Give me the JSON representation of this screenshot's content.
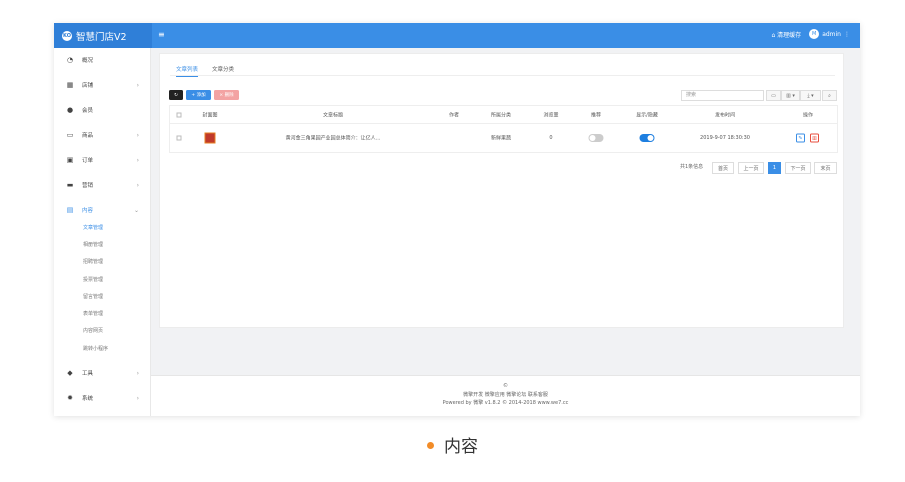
{
  "app": {
    "brand_logo": "KO",
    "brand_name": "智慧门店V2",
    "menu_toggle": "≡",
    "clear_cache": "清理缓存",
    "user_initial": "M",
    "user_name": "admin",
    "more_icon": "⋮"
  },
  "sidebar": {
    "items": [
      {
        "icon": "dashboard-icon",
        "glyph": "◔",
        "label": "概况",
        "has_arrow": false
      },
      {
        "icon": "grid-icon",
        "glyph": "▦",
        "label": "店铺",
        "has_arrow": true
      },
      {
        "icon": "users-icon",
        "glyph": "●",
        "label": "会员",
        "has_arrow": false
      },
      {
        "icon": "cart-icon",
        "glyph": "▭",
        "label": "商品",
        "has_arrow": true
      },
      {
        "icon": "order-icon",
        "glyph": "▣",
        "label": "订单",
        "has_arrow": true
      },
      {
        "icon": "flag-icon",
        "glyph": "▬",
        "label": "营销",
        "has_arrow": true
      },
      {
        "icon": "document-icon",
        "glyph": "▤",
        "label": "内容",
        "has_arrow": true
      },
      {
        "icon": "cube-icon",
        "glyph": "◆",
        "label": "工具",
        "has_arrow": true
      },
      {
        "icon": "gear-icon",
        "glyph": "✹",
        "label": "系统",
        "has_arrow": true
      }
    ],
    "sub_items": [
      "文章管理",
      "相册管理",
      "招聘管理",
      "投票管理",
      "留言管理",
      "表单管理",
      "内容网页",
      "跳转小程序"
    ]
  },
  "tabs": [
    "文章列表",
    "文章分类"
  ],
  "toolbar": {
    "refresh": "↻",
    "add": "+ 添加",
    "delete": "× 删除",
    "search_placeholder": "搜索",
    "view_btn": "▭",
    "columns_btn": "▥ ▾",
    "export_btn": "⤓ ▾",
    "search_btn": "⌕"
  },
  "table": {
    "headers": [
      "封面图",
      "文章标题",
      "作者",
      "所属分类",
      "浏览量",
      "推荐",
      "显示/隐藏",
      "发布时间",
      "操作"
    ],
    "rows": [
      {
        "title": "黄河金三角果园产业园总体简介：让亿人...",
        "author": "",
        "category": "新鲜果蔬",
        "views": "0",
        "recommended": false,
        "visible": true,
        "published": "2019-9-07 18:30:30"
      }
    ]
  },
  "pager": {
    "summary": "共1条信息",
    "first": "首页",
    "prev": "上一页",
    "current": "1",
    "next": "下一页",
    "last": "末页"
  },
  "footer": {
    "line1": "©",
    "line2": "微擎开发 微擎应用 微擎论坛 联系客服",
    "line3": "Powered by 微擎 v1.8.2 © 2014-2018 www.we7.cc"
  },
  "caption": "内容",
  "colors": {
    "primary": "#3a8ee6",
    "danger": "#f08a8a",
    "accent": "#f28c28"
  }
}
